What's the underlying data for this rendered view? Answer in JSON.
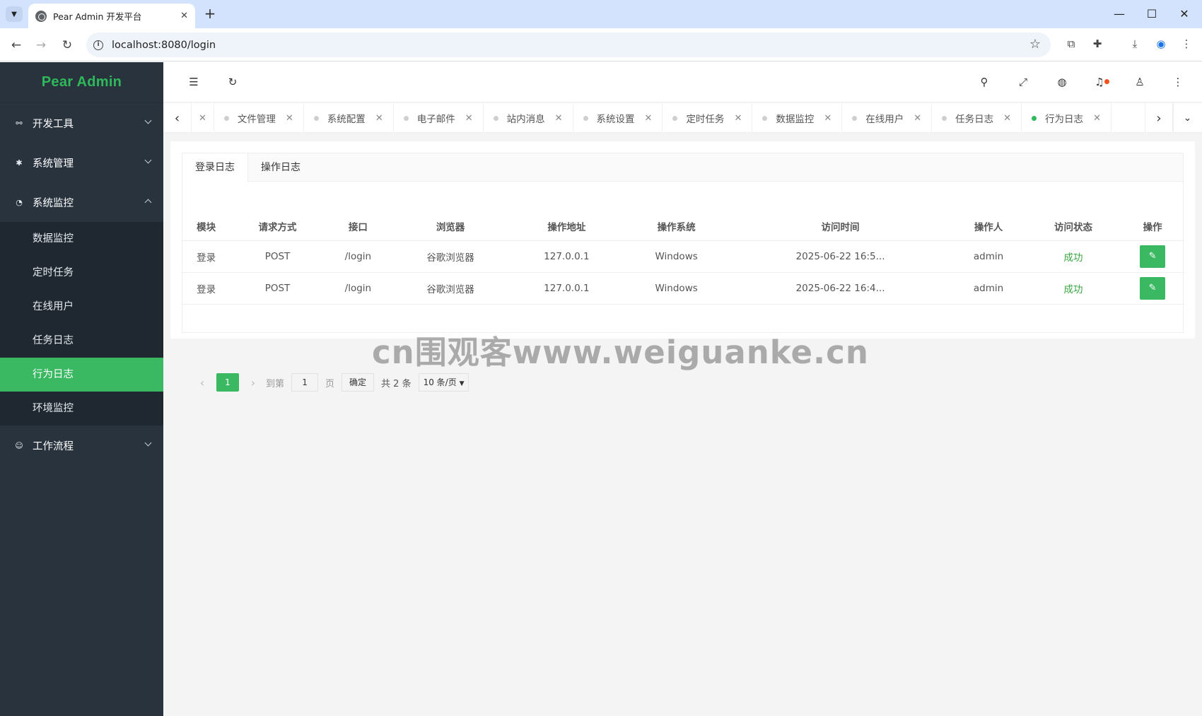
{
  "browser": {
    "tab_title": "Pear Admin 开发平台",
    "url": "localhost:8080/login"
  },
  "sidebar": {
    "logo": "Pear Admin",
    "groups": [
      {
        "label": "开发工具",
        "icon": "link-icon",
        "expanded": false
      },
      {
        "label": "系统管理",
        "icon": "gear-icon",
        "expanded": false
      },
      {
        "label": "系统监控",
        "icon": "dashboard-icon",
        "expanded": true
      },
      {
        "label": "工作流程",
        "icon": "smile-icon",
        "expanded": false
      }
    ],
    "monitor_items": [
      "数据监控",
      "定时任务",
      "在线用户",
      "任务日志",
      "行为日志",
      "环境监控"
    ],
    "active_item": "行为日志"
  },
  "page_tabs": [
    "文件管理",
    "系统配置",
    "电子邮件",
    "站内消息",
    "系统设置",
    "定时任务",
    "数据监控",
    "在线用户",
    "任务日志",
    "行为日志"
  ],
  "active_page_tab": "行为日志",
  "log_tabs": [
    "登录日志",
    "操作日志"
  ],
  "table": {
    "headers": [
      "模块",
      "请求方式",
      "接口",
      "浏览器",
      "操作地址",
      "操作系统",
      "访问时间",
      "操作人",
      "访问状态",
      "操作"
    ],
    "rows": [
      [
        "登录",
        "POST",
        "/login",
        "谷歌浏览器",
        "127.0.0.1",
        "Windows",
        "2025-06-22 16:5...",
        "admin",
        "成功"
      ],
      [
        "登录",
        "POST",
        "/login",
        "谷歌浏览器",
        "127.0.0.1",
        "Windows",
        "2025-06-22 16:4...",
        "admin",
        "成功"
      ]
    ]
  },
  "pager": {
    "current_page": "1",
    "goto_label": "到第",
    "goto_value": "1",
    "page_unit": "页",
    "confirm": "确定",
    "total": "共 2 条",
    "page_size": "10 条/页"
  },
  "watermark": "cn围观客www.weiguanke.cn",
  "colors": {
    "accent": "#3ab862",
    "sidebar": "#28333e",
    "status_success": "#38a542"
  }
}
